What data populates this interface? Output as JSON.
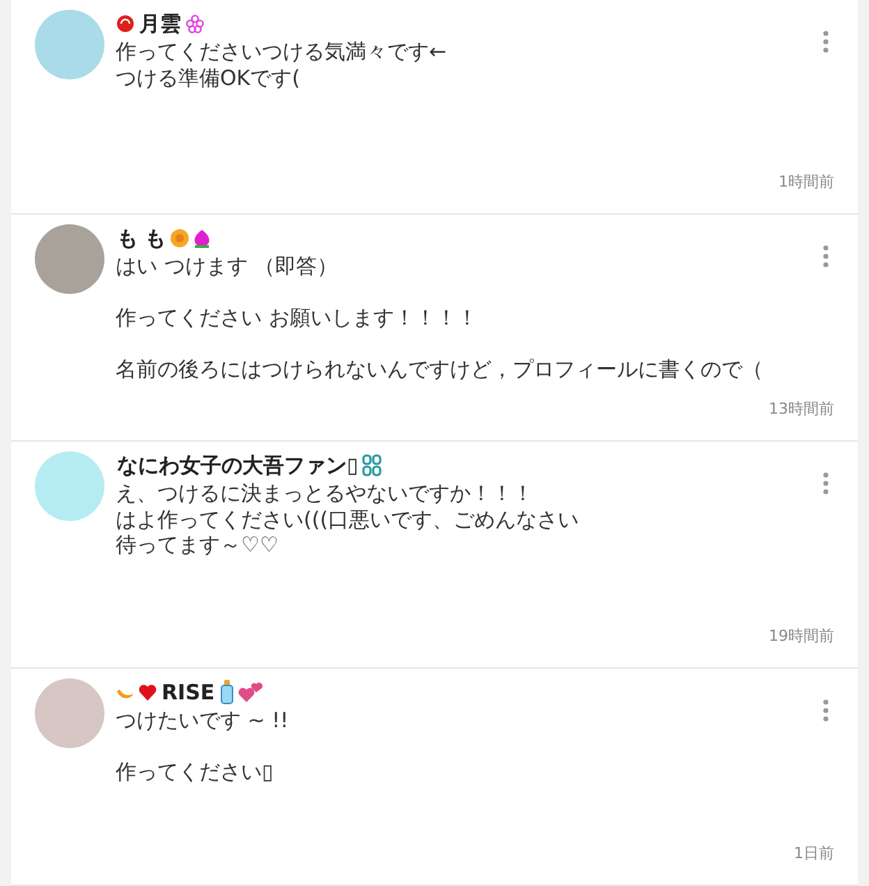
{
  "comments": [
    {
      "name": "月雲",
      "paragraphs": [
        [
          "作ってくださいつける気満々です←",
          "つける準備OKです("
        ]
      ],
      "time": "1時間前"
    },
    {
      "name": "も も",
      "paragraphs": [
        [
          "はい つけます （即答）"
        ],
        [
          "作ってください お願いします！！！！"
        ],
        [
          "名前の後ろにはつけられないんですけど，プロフィールに書くので（"
        ]
      ],
      "time": "13時間前"
    },
    {
      "name": "なにわ女子の大吾ファン▯",
      "paragraphs": [
        [
          "え、つけるに決まっとるやないですか！！！",
          "はよ作ってください(((口悪いです、ごめんなさい",
          "待ってます～♡♡"
        ]
      ],
      "time": "19時間前"
    },
    {
      "name": "RISE",
      "paragraphs": [
        [
          "つけたいです ~ !!"
        ],
        [
          "作ってください▯"
        ]
      ],
      "time": "1日前"
    }
  ]
}
